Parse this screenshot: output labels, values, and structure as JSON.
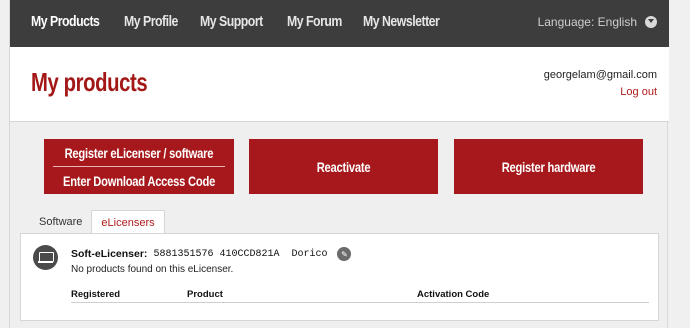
{
  "nav": {
    "items": [
      "My Products",
      "My Profile",
      "My Support",
      "My Forum",
      "My Newsletter"
    ],
    "language": "Language: English"
  },
  "header": {
    "title": "My products",
    "email": "georgelam@gmail.com",
    "logout": "Log out"
  },
  "actions": {
    "register_elicenser": "Register eLicenser / software",
    "enter_code": "Enter Download Access Code",
    "reactivate": "Reactivate",
    "register_hardware": "Register hardware"
  },
  "tabs": [
    "Software",
    "eLicensers"
  ],
  "elicenser": {
    "label": "Soft-eLicenser:",
    "serial": "5881351576 410CCD821A",
    "name": "Dorico",
    "message": "No products found on this eLicenser."
  },
  "table": {
    "columns": [
      "Registered",
      "Product",
      "Activation Code"
    ]
  },
  "colors": {
    "accent": "#a6181b",
    "nav_bg": "#3d3d3d"
  },
  "icons": [
    "chevron-down-icon",
    "device-icon",
    "edit-icon"
  ]
}
